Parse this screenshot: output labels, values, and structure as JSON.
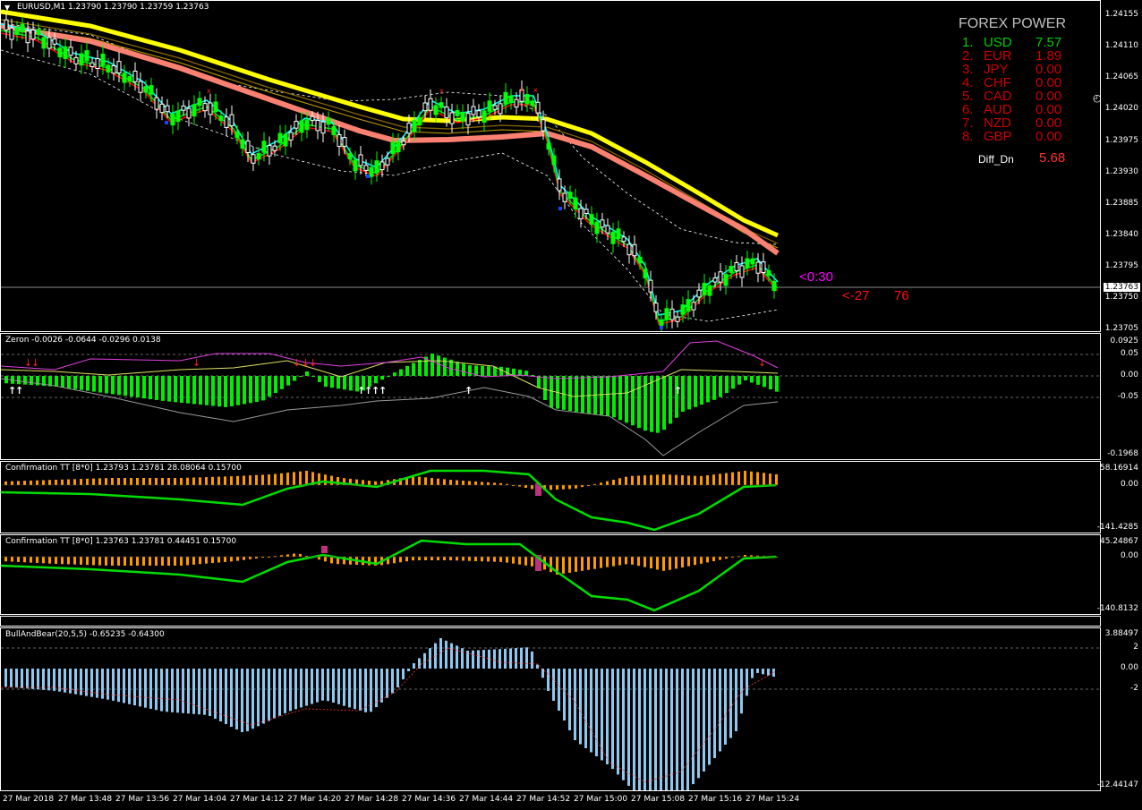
{
  "main": {
    "title": "EURUSD,M1  1.23790 1.23790 1.23759 1.23763",
    "price_labels": [
      "1.24155",
      "1.24110",
      "1.24065",
      "1.24020",
      "1.23975",
      "1.23930",
      "1.23885",
      "1.23840",
      "1.23795",
      "1.23763",
      "1.23750",
      "1.23705"
    ],
    "current_price": "1.23763",
    "timer": "<0:30",
    "spread_a": "<-27",
    "spread_b": "76",
    "colors": {
      "bull": "#ffffff",
      "bear": "#00ff00",
      "ma_yellow": "#ffff00",
      "ma_salmon": "#fa8072"
    }
  },
  "forex_power": {
    "title": "FOREX POWER",
    "rows": [
      {
        "rank": "1.",
        "cur": "USD",
        "val": "7.57",
        "color": "#00cc00"
      },
      {
        "rank": "2.",
        "cur": "EUR",
        "val": "1.89",
        "color": "#cc0000"
      },
      {
        "rank": "3.",
        "cur": "JPY",
        "val": "0.00",
        "color": "#cc0000"
      },
      {
        "rank": "4.",
        "cur": "CHF",
        "val": "0.00",
        "color": "#cc0000"
      },
      {
        "rank": "5.",
        "cur": "CAD",
        "val": "0.00",
        "color": "#cc0000"
      },
      {
        "rank": "6.",
        "cur": "AUD",
        "val": "0.00",
        "color": "#cc0000"
      },
      {
        "rank": "7.",
        "cur": "NZD",
        "val": "0.00",
        "color": "#cc0000"
      },
      {
        "rank": "8.",
        "cur": "GBP",
        "val": "0.00",
        "color": "#cc0000"
      }
    ],
    "diff_label": "Diff_Dn",
    "diff_value": "5.68"
  },
  "zeron": {
    "title": "Zeron -0.0026 -0.0644 -0.0296 0.0138",
    "labels": [
      "0.0925",
      "0.05",
      "0.00",
      "-0.05",
      "-0.1968"
    ]
  },
  "conf1": {
    "title": "Confirmation TT [8*0] 1.23793 1.23781 28.08064 0.15700",
    "labels": [
      "58.16914",
      "0.00",
      "-141.4285"
    ]
  },
  "conf2": {
    "title": "Confirmation TT [8*0] 1.23763 1.23781 0.44451 0.15700",
    "labels": [
      "45.24867",
      "0.00",
      "-140.8132"
    ]
  },
  "bullbear": {
    "title": "BullAndBear(20,5,5) -0.65235 -0.64300",
    "labels": [
      "3.88497",
      "2",
      "0.00",
      "-2",
      "-12.44147"
    ]
  },
  "time_axis": [
    "27 Mar 2018",
    "27 Mar 13:48",
    "27 Mar 13:56",
    "27 Mar 14:04",
    "27 Mar 14:12",
    "27 Mar 14:20",
    "27 Mar 14:28",
    "27 Mar 14:36",
    "27 Mar 14:44",
    "27 Mar 14:52",
    "27 Mar 15:00",
    "27 Mar 15:08",
    "27 Mar 15:16",
    "27 Mar 15:24"
  ]
}
